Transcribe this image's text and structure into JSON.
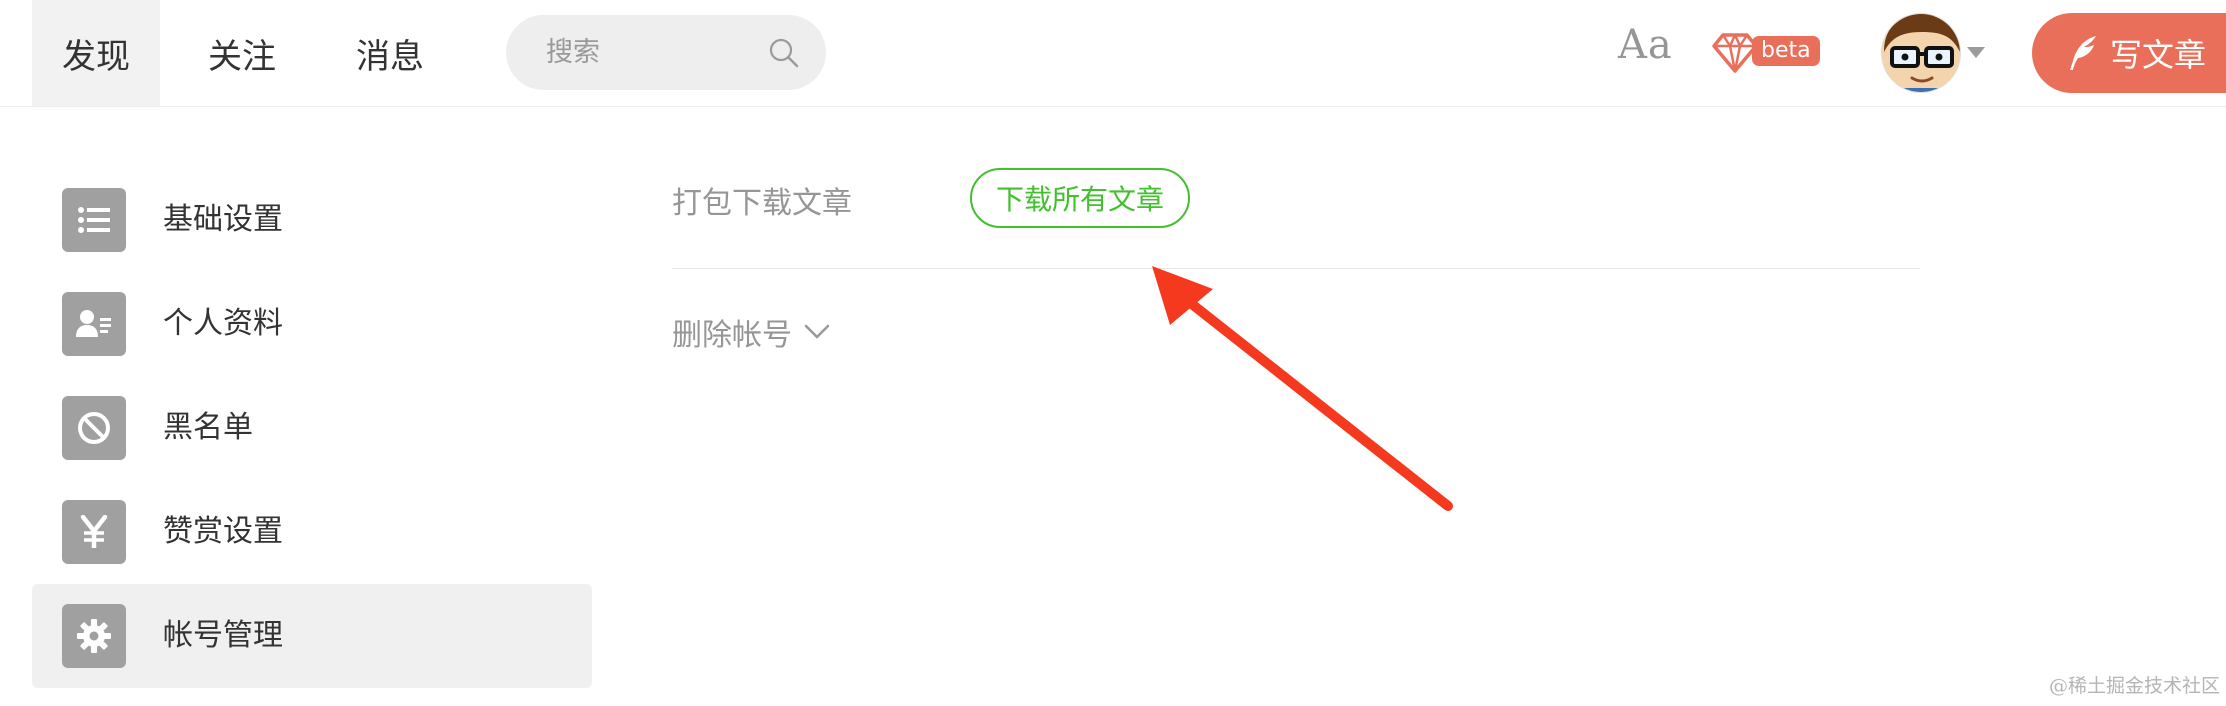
{
  "nav": {
    "tabs": [
      {
        "label": "发现",
        "active": true
      },
      {
        "label": "关注",
        "active": false
      },
      {
        "label": "消息",
        "active": false
      }
    ],
    "search_placeholder": "搜索",
    "font_toggle_label": "Aa",
    "beta_badge": "beta",
    "write_button_label": "写文章"
  },
  "sidebar": {
    "items": [
      {
        "label": "基础设置",
        "icon": "list-icon",
        "active": false
      },
      {
        "label": "个人资料",
        "icon": "profile-card-icon",
        "active": false
      },
      {
        "label": "黑名单",
        "icon": "block-icon",
        "active": false
      },
      {
        "label": "赞赏设置",
        "icon": "yen-icon",
        "active": false
      },
      {
        "label": "帐号管理",
        "icon": "gear-icon",
        "active": true
      }
    ]
  },
  "main": {
    "download_row_label": "打包下载文章",
    "download_button_label": "下载所有文章",
    "delete_account_label": "删除帐号"
  },
  "watermark": "@稀土掘金技术社区",
  "colors": {
    "accent": "#ea6f5a",
    "green": "#42c02e",
    "muted_text": "#969696",
    "icon_tile": "#a0a0a0",
    "annotation_arrow": "#f5391f"
  }
}
